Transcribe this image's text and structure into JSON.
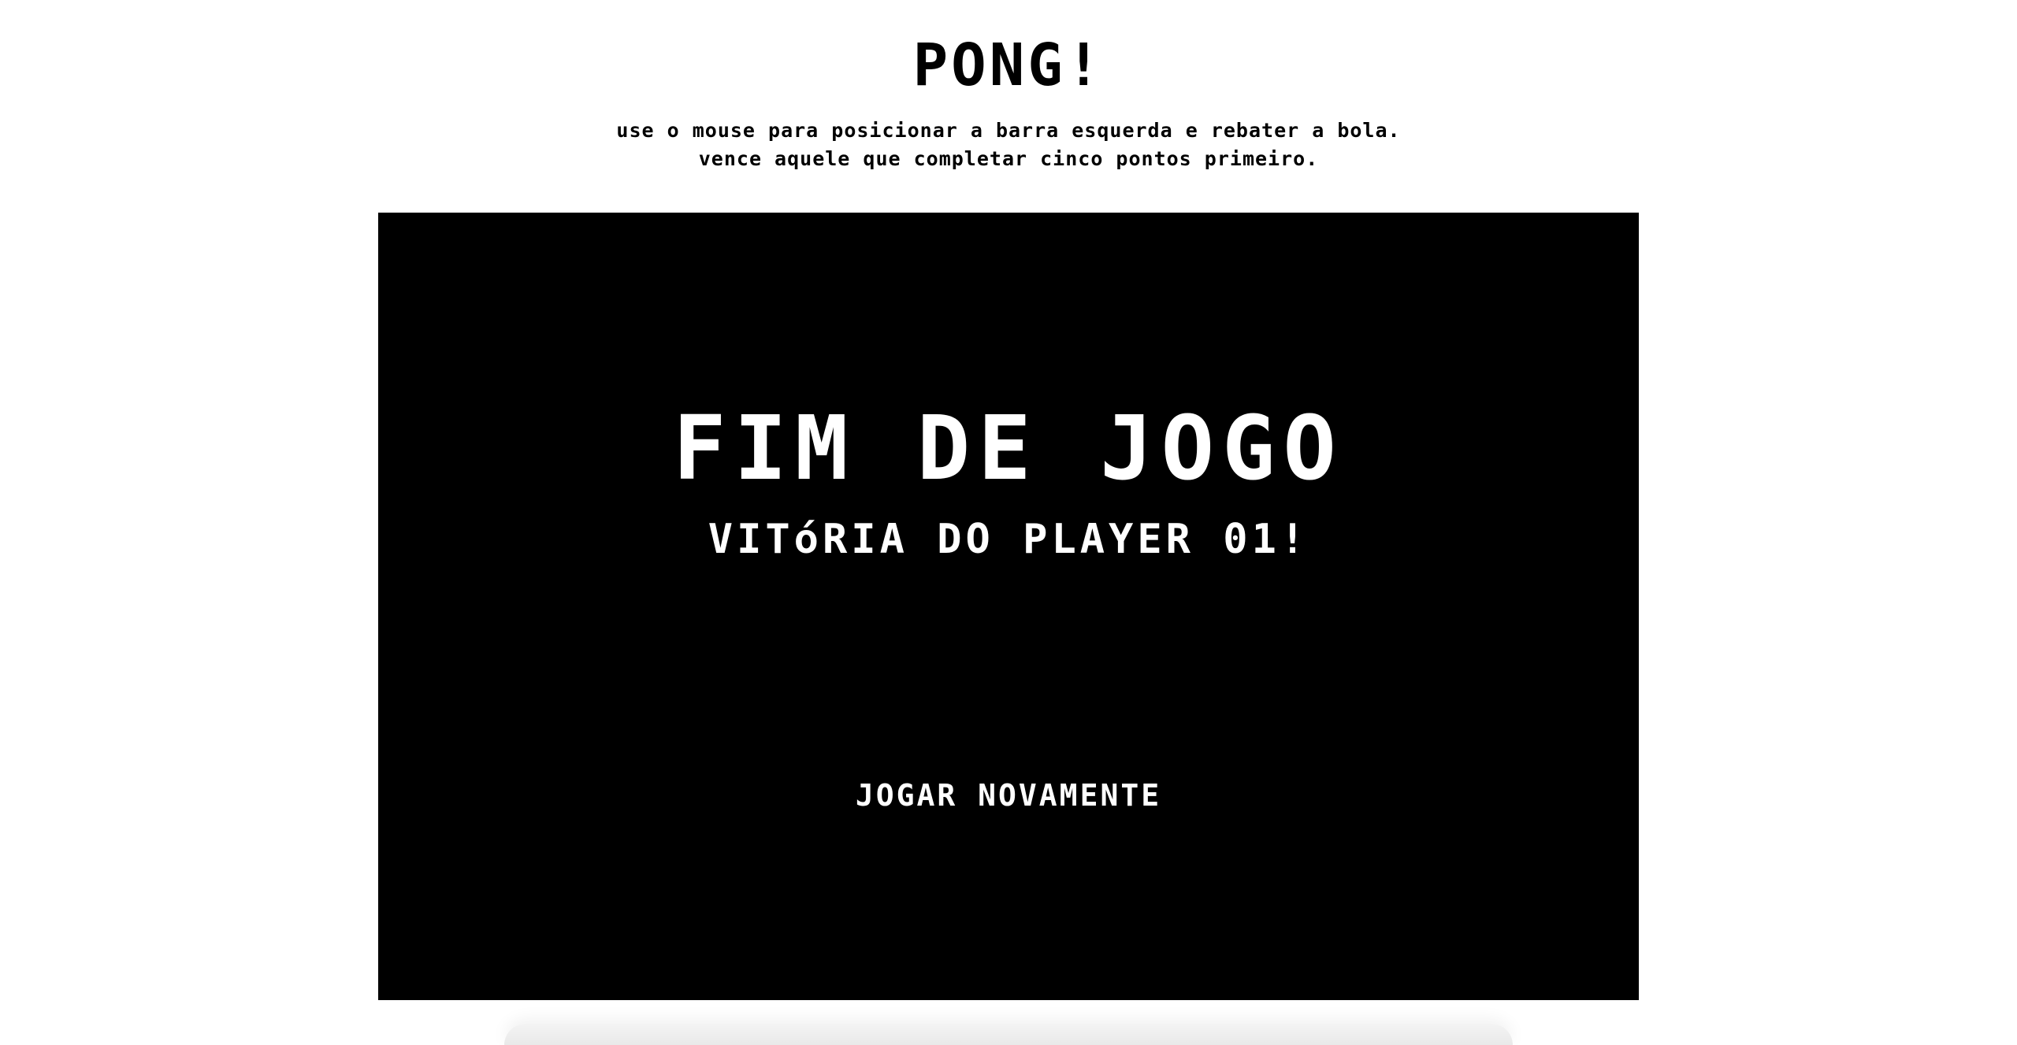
{
  "header": {
    "title": "PONG!",
    "instructions": [
      "use o mouse para posicionar a barra esquerda e rebater a bola.",
      "vence aquele que completar cinco pontos primeiro."
    ]
  },
  "game": {
    "background_color": "#000000",
    "text_color": "#ffffff",
    "game_over_title": "FIM DE JOGO",
    "winner_message": "VITóRIA DO PLAYER 01!",
    "replay_label": "JOGAR NOVAMENTE"
  }
}
